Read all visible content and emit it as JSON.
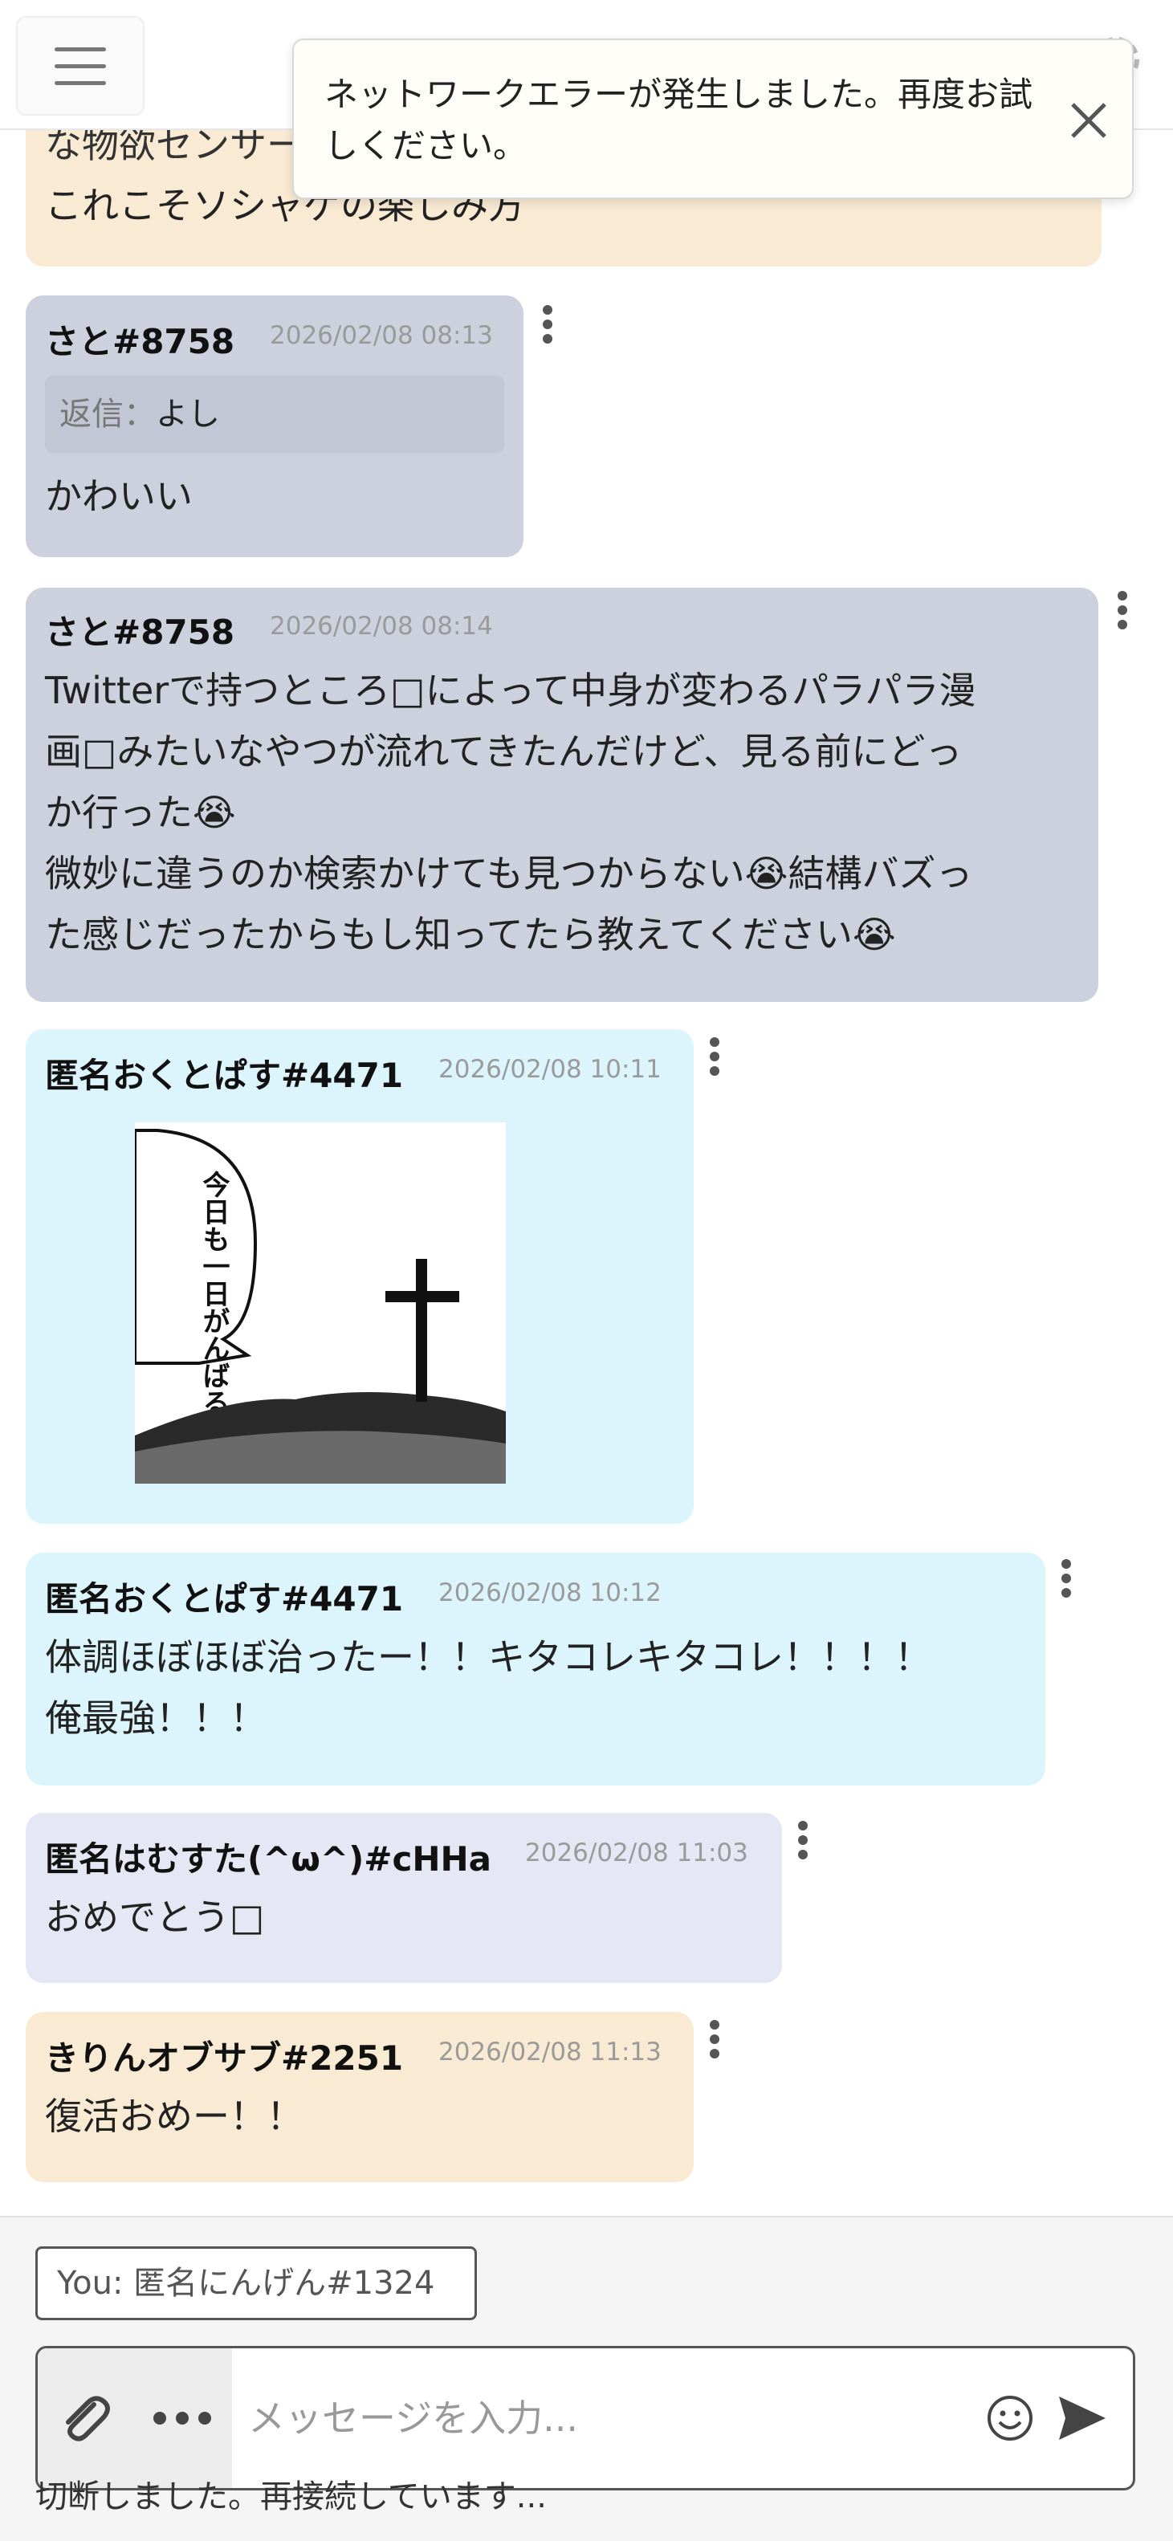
{
  "toast": {
    "message": "ネットワークエラーが発生しました。再度お試しください。"
  },
  "partial_message": {
    "line1": "な物欲センサーとかほし治から脱却する",
    "line2": "これこそソシャゲの楽しみ方"
  },
  "messages": [
    {
      "name": "さと#8758",
      "time": "2026/02/08 08:13",
      "reply_label": "返信：",
      "reply_to": "よし",
      "lines": [
        "かわいい"
      ]
    },
    {
      "name": "さと#8758",
      "time": "2026/02/08 08:14",
      "lines": [
        "Twitterで持つところ□によって中身が変わるパラパラ漫",
        "画□みたいなやつが流れてきたんだけど、見る前にどっ",
        "か行った😭",
        "微妙に違うのか検索かけても見つからない😭結構バズっ",
        "た感じだったからもし知ってたら教えてください😭"
      ]
    },
    {
      "name": "匿名おくとぱす#4471",
      "time": "2026/02/08 10:11",
      "image_text": "今日も一日がんばるぞい！"
    },
    {
      "name": "匿名おくとぱす#4471",
      "time": "2026/02/08 10:12",
      "lines": [
        "体調ほぼほぼ治ったー！！キタコレキタコレ！！！！",
        "俺最強！！！"
      ]
    },
    {
      "name": "匿名はむすた(^ω^)#cHHa",
      "time": "2026/02/08 11:03",
      "lines": [
        "おめでとう□"
      ]
    },
    {
      "name": "きりんオブサブ#2251",
      "time": "2026/02/08 11:13",
      "lines": [
        "復活おめー！！"
      ]
    }
  ],
  "composer": {
    "you_label": "You: 匿名にんげん#1324",
    "placeholder": "メッセージを入力...",
    "status": "切断しました。再接続しています..."
  }
}
